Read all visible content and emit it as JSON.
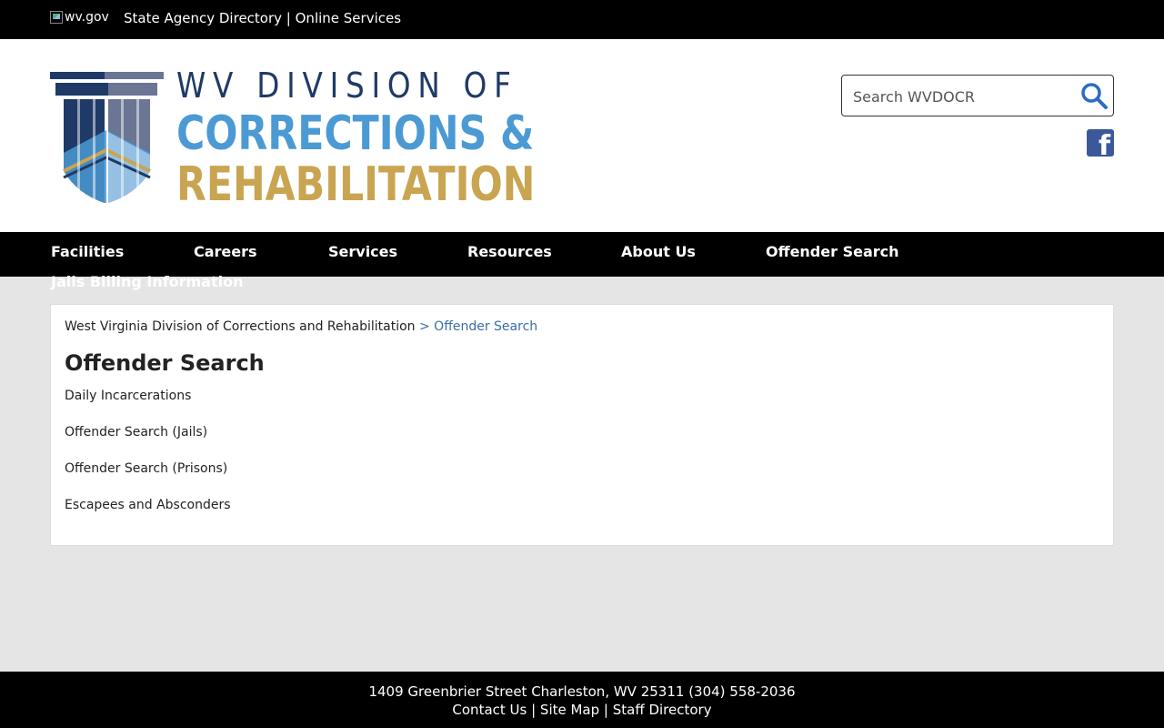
{
  "topbar": {
    "logo_alt": "wv.gov",
    "links": [
      {
        "label": "State Agency Directory"
      },
      {
        "label": "Online Services"
      }
    ],
    "separator": " | "
  },
  "header": {
    "logo_line1": "WV DIVISION OF",
    "logo_line2": "CORRECTIONS &",
    "logo_line3": "REHABILITATION",
    "search_placeholder": "Search WVDOCR",
    "colors": {
      "navy": "#1f3a66",
      "blue": "#4b9ad4",
      "gold": "#c9a552",
      "facebook": "#3b5998"
    }
  },
  "nav": {
    "items": [
      {
        "label": "Facilities"
      },
      {
        "label": "Careers"
      },
      {
        "label": "Services"
      },
      {
        "label": "Resources"
      },
      {
        "label": "About Us"
      },
      {
        "label": "Offender Search"
      }
    ],
    "overflow_item": "Jails Billing Information"
  },
  "breadcrumb": {
    "home": "West Virginia Division of Corrections and Rehabilitation",
    "current": "> Offender Search"
  },
  "main": {
    "title": "Offender Search",
    "links": [
      {
        "label": "Daily Incarcerations"
      },
      {
        "label": "Offender Search (Jails)"
      },
      {
        "label": "Offender Search (Prisons)"
      },
      {
        "label": "Escapees and Absconders"
      }
    ]
  },
  "footer": {
    "address": "1409 Greenbrier Street Charleston, WV 25311 (304) 558-2036",
    "links": [
      {
        "label": "Contact Us"
      },
      {
        "label": "Site Map"
      },
      {
        "label": "Staff Directory"
      }
    ],
    "separator": " | "
  }
}
